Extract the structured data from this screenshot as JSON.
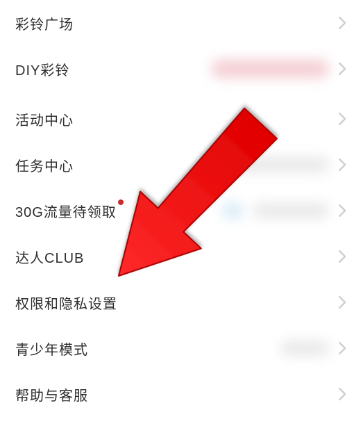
{
  "rows": [
    {
      "label": "彩铃广场",
      "dot": false
    },
    {
      "label": "DIY彩铃",
      "dot": false
    },
    {
      "label": "活动中心",
      "dot": false
    },
    {
      "label": "任务中心",
      "dot": false
    },
    {
      "label": "30G流量待领取",
      "dot": true
    },
    {
      "label": "达人CLUB",
      "dot": false
    },
    {
      "label": "权限和隐私设置",
      "dot": false
    },
    {
      "label": "青少年模式",
      "dot": false
    },
    {
      "label": "帮助与客服",
      "dot": false
    }
  ]
}
